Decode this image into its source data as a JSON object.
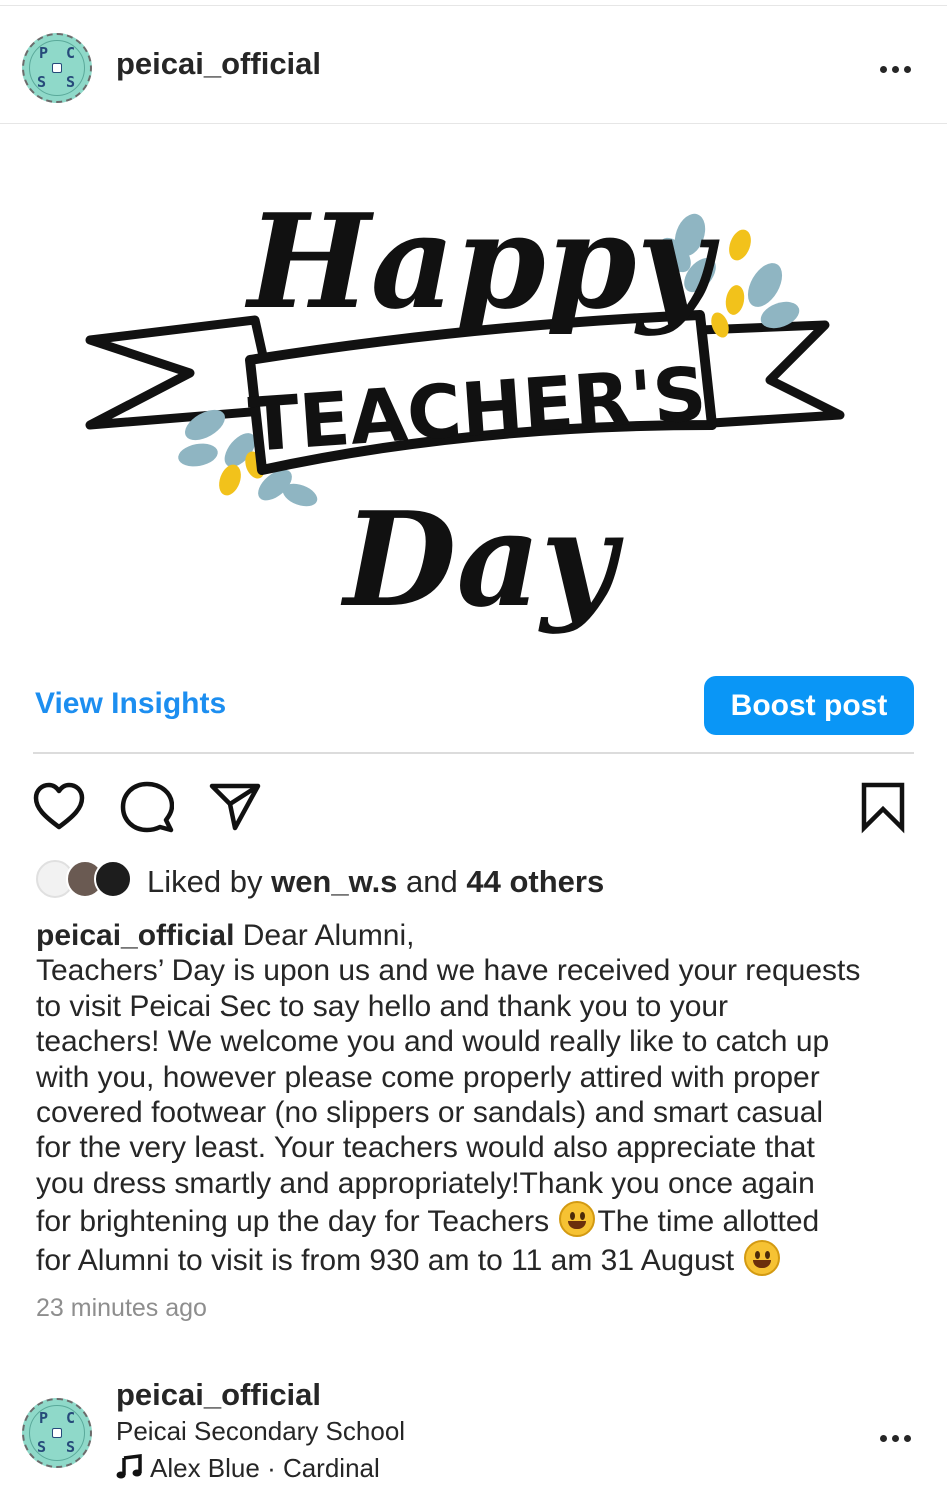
{
  "post": {
    "username": "peicai_official",
    "avatar_letters": [
      "P",
      "C",
      "S",
      "S"
    ],
    "image": {
      "line1": "Happy",
      "line2": "TEACHER'S",
      "line3": "Day"
    },
    "insights_label": "View Insights",
    "boost_label": "Boost post",
    "icons": [
      "heart-icon",
      "comment-icon",
      "share-icon",
      "bookmark-icon",
      "more-icon"
    ],
    "likes": {
      "prefix": "Liked by ",
      "user": "wen_w.s",
      "middle": " and ",
      "others": "44 others"
    },
    "caption": {
      "author": "peicai_official",
      "lines": [
        " Dear Alumni,",
        "Teachers’ Day is upon us and we have received your requests",
        "to visit Peicai Sec to say hello and thank you to your",
        "teachers! We welcome you and would really like to catch up",
        "with you, however please come properly attired with proper",
        "covered footwear (no slippers or sandals) and smart casual",
        "for the very least. Your teachers would also appreciate that",
        "you dress smartly and appropriately!Thank you once again",
        "for brightening up the day for Teachers ",
        "The time allotted",
        "for Alumni to visit is from 930 am to 11 am 31 August "
      ]
    },
    "timestamp": "23 minutes ago"
  },
  "next_post": {
    "username": "peicai_official",
    "location": "Peicai Secondary School",
    "music": "Alex Blue · Cardinal"
  },
  "colors": {
    "accent": "#0a96f6",
    "link": "#1c8ef0",
    "avatar_bg": "#8fd9c9",
    "text": "#262626",
    "muted": "#8e8e8e"
  }
}
